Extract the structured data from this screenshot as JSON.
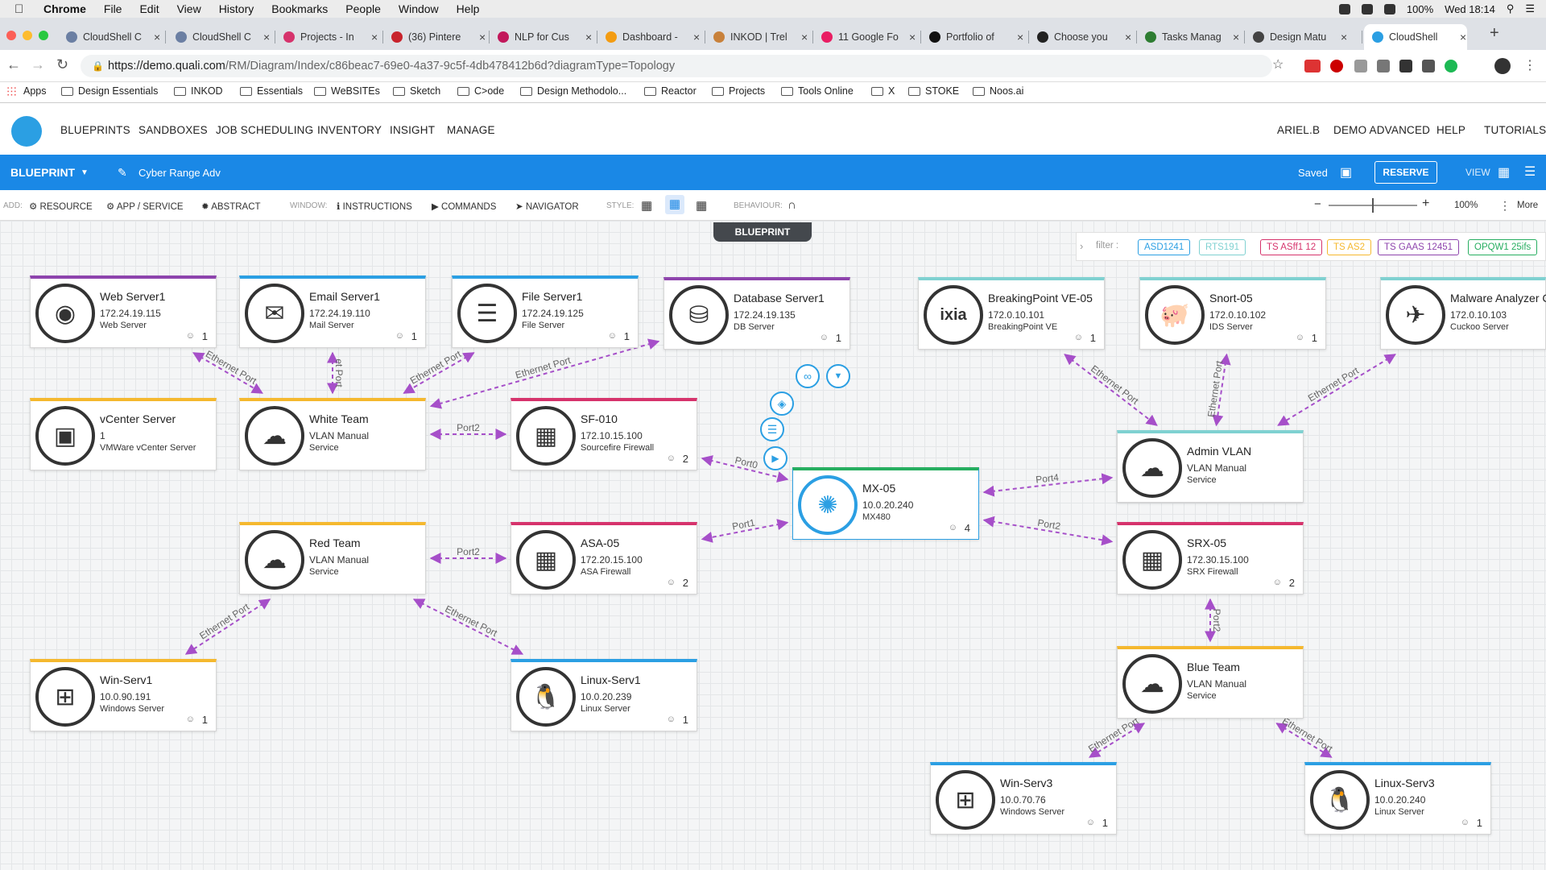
{
  "os_menu": {
    "app": "Chrome",
    "items": [
      "File",
      "Edit",
      "View",
      "History",
      "Bookmarks",
      "People",
      "Window",
      "Help"
    ],
    "battery": "100%",
    "clock": "Wed 18:14"
  },
  "tabs": [
    {
      "label": "CloudShell C",
      "color": "#6b7fa3"
    },
    {
      "label": "CloudShell C",
      "color": "#6b7fa3"
    },
    {
      "label": "Projects - In",
      "color": "#d6336c"
    },
    {
      "label": "(36) Pintere",
      "color": "#c8232c"
    },
    {
      "label": "NLP for Cus",
      "color": "#c2185b"
    },
    {
      "label": "Dashboard -",
      "color": "#f39c12"
    },
    {
      "label": "INKOD | Trel",
      "color": "#c8813b"
    },
    {
      "label": "11 Google Fo",
      "color": "#e91e63"
    },
    {
      "label": "Portfolio of",
      "color": "#111111"
    },
    {
      "label": "Choose you",
      "color": "#222222"
    },
    {
      "label": "Tasks Manag",
      "color": "#2e7d32"
    },
    {
      "label": "Design Matu",
      "color": "#444444"
    },
    {
      "label": "CloudShell",
      "color": "#2b9fe3"
    }
  ],
  "address": {
    "url_host": "https://demo.quali.com",
    "url_path": "/RM/Diagram/Index/c86beac7-69e0-4a37-9c5f-4db478412b6d?diagramType=Topology"
  },
  "bookmarks": [
    "Apps",
    "Design Essentials",
    "INKOD",
    "Essentials",
    "WeBSITEs",
    "Sketch",
    "C>ode",
    "Design Methodolo...",
    "Reactor",
    "Projects",
    "Tools Online",
    "X",
    "STOKE",
    "Noos.ai"
  ],
  "app_nav": {
    "left": [
      "BLUEPRINTS",
      "SANDBOXES",
      "JOB SCHEDULING",
      "INVENTORY",
      "INSIGHT",
      "MANAGE"
    ],
    "right": [
      "ARIEL.B",
      "DEMO ADVANCED",
      "HELP",
      "TUTORIALS"
    ]
  },
  "bluebar": {
    "mode": "BLUEPRINT",
    "name": "Cyber Range Adv",
    "saved": "Saved",
    "reserve": "RESERVE",
    "view": "VIEW"
  },
  "toolbar": {
    "add_label": "ADD:",
    "resource": "RESOURCE",
    "app_service": "APP / SERVICE",
    "abstract": "ABSTRACT",
    "window_label": "WINDOW:",
    "instructions": "INSTRUCTIONS",
    "commands": "COMMANDS",
    "navigator": "NAVIGATOR",
    "style_label": "STYLE:",
    "behaviour_label": "BEHAVIOUR:",
    "zoom": "100%",
    "more": "More"
  },
  "canvas": {
    "tag": "BLUEPRINT",
    "filter_label": "filter :",
    "filters": [
      {
        "label": "ASD1241",
        "color": "#2b9fe3"
      },
      {
        "label": "RTS191",
        "color": "#7fd1d1"
      },
      {
        "label": "TS ASff1 12",
        "color": "#d6336c"
      },
      {
        "label": "TS AS2",
        "color": "#f5b82e"
      },
      {
        "label": "TS GAAS 12451",
        "color": "#8e44ad"
      },
      {
        "label": "OPQW1 25ifs",
        "color": "#27ae60"
      }
    ]
  },
  "nodes": [
    {
      "id": "web",
      "name": "Web Server1",
      "ip": "172.24.19.115",
      "type": "Web Server",
      "count": "1",
      "color": "#8e44ad",
      "icon": "◉"
    },
    {
      "id": "email",
      "name": "Email Server1",
      "ip": "172.24.19.110",
      "type": "Mail Server",
      "count": "1",
      "color": "#2b9fe3",
      "icon": "✉"
    },
    {
      "id": "file",
      "name": "File Server1",
      "ip": "172.24.19.125",
      "type": "File Server",
      "count": "1",
      "color": "#2b9fe3",
      "icon": "☰"
    },
    {
      "id": "db",
      "name": "Database Server1",
      "ip": "172.24.19.135",
      "type": "DB Server",
      "count": "1",
      "color": "#8e44ad",
      "icon": "⛁"
    },
    {
      "id": "bp",
      "name": "BreakingPoint VE-05",
      "ip": "172.0.10.101",
      "type": "BreakingPoint VE",
      "count": "1",
      "color": "#7fd1d1",
      "icon": "ixia"
    },
    {
      "id": "snort",
      "name": "Snort-05",
      "ip": "172.0.10.102",
      "type": "IDS Server",
      "count": "1",
      "color": "#7fd1d1",
      "icon": "🐖"
    },
    {
      "id": "malware",
      "name": "Malware Analyzer C",
      "ip": "172.0.10.103",
      "type": "Cuckoo Server",
      "count": "",
      "color": "#7fd1d1",
      "icon": "✈"
    },
    {
      "id": "vcenter",
      "name": "vCenter Server",
      "ip": "1",
      "type": "VMWare vCenter Server",
      "count": "",
      "color": "#f5b82e",
      "icon": "▣"
    },
    {
      "id": "white",
      "name": "White Team",
      "ip": "VLAN Manual",
      "type": "Service",
      "count": "",
      "color": "#f5b82e",
      "icon": "☁"
    },
    {
      "id": "sf",
      "name": "SF-010",
      "ip": "172.10.15.100",
      "type": "Sourcefire Firewall",
      "count": "2",
      "color": "#d6336c",
      "icon": "▦"
    },
    {
      "id": "mx",
      "name": "MX-05",
      "ip": "10.0.20.240",
      "type": "MX480",
      "count": "4",
      "color": "#27ae60",
      "icon": "✺"
    },
    {
      "id": "adminvlan",
      "name": "Admin VLAN",
      "ip": "VLAN Manual",
      "type": "Service",
      "count": "",
      "color": "#7fd1d1",
      "icon": "☁"
    },
    {
      "id": "red",
      "name": "Red Team",
      "ip": "VLAN Manual",
      "type": "Service",
      "count": "",
      "color": "#f5b82e",
      "icon": "☁"
    },
    {
      "id": "asa",
      "name": "ASA-05",
      "ip": "172.20.15.100",
      "type": "ASA Firewall",
      "count": "2",
      "color": "#d6336c",
      "icon": "▦"
    },
    {
      "id": "srx",
      "name": "SRX-05",
      "ip": "172.30.15.100",
      "type": "SRX Firewall",
      "count": "2",
      "color": "#d6336c",
      "icon": "▦"
    },
    {
      "id": "win1",
      "name": "Win-Serv1",
      "ip": "10.0.90.191",
      "type": "Windows Server",
      "count": "1",
      "color": "#f5b82e",
      "icon": "⊞"
    },
    {
      "id": "linux1",
      "name": "Linux-Serv1",
      "ip": "10.0.20.239",
      "type": "Linux Server",
      "count": "1",
      "color": "#2b9fe3",
      "icon": "🐧"
    },
    {
      "id": "blue",
      "name": "Blue Team",
      "ip": "VLAN Manual",
      "type": "Service",
      "count": "",
      "color": "#f5b82e",
      "icon": "☁"
    },
    {
      "id": "win3",
      "name": "Win-Serv3",
      "ip": "10.0.70.76",
      "type": "Windows Server",
      "count": "1",
      "color": "#2b9fe3",
      "icon": "⊞"
    },
    {
      "id": "linux3",
      "name": "Linux-Serv3",
      "ip": "10.0.20.240",
      "type": "Linux Server",
      "count": "1",
      "color": "#2b9fe3",
      "icon": "🐧"
    }
  ],
  "links": [
    {
      "from": "web",
      "to": "white",
      "label": "Ethernet Port"
    },
    {
      "from": "email",
      "to": "white",
      "label": "et Port"
    },
    {
      "from": "file",
      "to": "white",
      "label": "Ethernet Port"
    },
    {
      "from": "db",
      "to": "white",
      "label": "Ethernet Port"
    },
    {
      "from": "white",
      "to": "sf",
      "label": "Port2"
    },
    {
      "from": "sf",
      "to": "mx",
      "label": "Port0"
    },
    {
      "from": "mx",
      "to": "asa",
      "label": "Port1"
    },
    {
      "from": "red",
      "to": "asa",
      "label": "Port2"
    },
    {
      "from": "red",
      "to": "win1",
      "label": "Ethernet Port"
    },
    {
      "from": "red",
      "to": "linux1",
      "label": "Ethernet Port"
    },
    {
      "from": "bp",
      "to": "adminvlan",
      "label": "Ethernet Port"
    },
    {
      "from": "snort",
      "to": "adminvlan",
      "label": "Ethernet Port"
    },
    {
      "from": "malware",
      "to": "adminvlan",
      "label": "Ethernet Port"
    },
    {
      "from": "mx",
      "to": "adminvlan",
      "label": "Port4"
    },
    {
      "from": "mx",
      "to": "srx",
      "label": "Port2"
    },
    {
      "from": "srx",
      "to": "blue",
      "label": "Port2"
    },
    {
      "from": "blue",
      "to": "win3",
      "label": "Ethernet Port"
    },
    {
      "from": "blue",
      "to": "linux3",
      "label": "Ethernet Port"
    }
  ]
}
